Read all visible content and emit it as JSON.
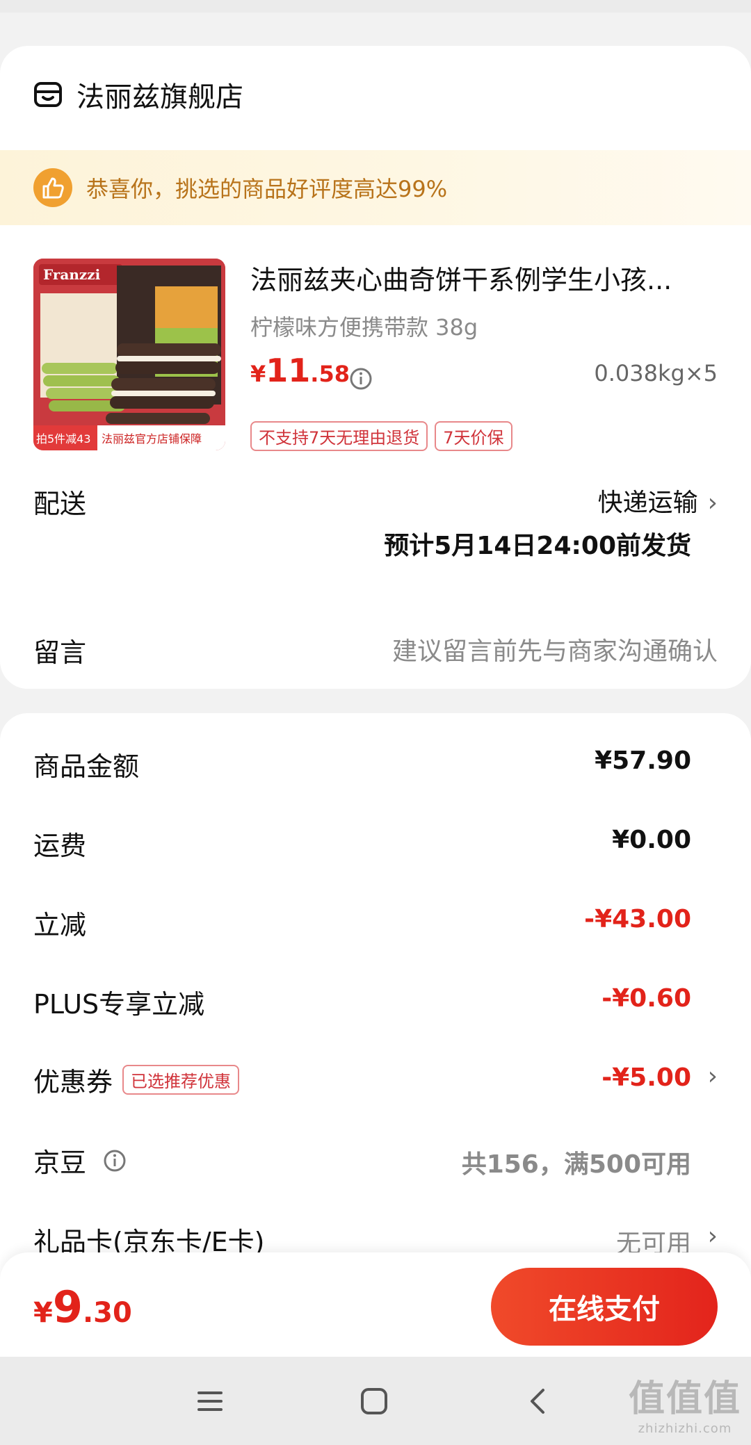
{
  "store": {
    "name": "法丽兹旗舰店",
    "icon": "store-icon"
  },
  "banner": {
    "text": "恭喜你，挑选的商品好评度高达99%",
    "icon": "thumbs-up-icon"
  },
  "product": {
    "title": "法丽兹夹心曲奇饼干系例学生小孩...",
    "spec": "柠檬味方便携带款 38g",
    "price_symbol": "¥",
    "price_int": "11",
    "price_dec": ".58",
    "qty": "0.038kg×5",
    "tags": [
      "不支持7天无理由退货",
      "7天价保"
    ],
    "image": {
      "brand": "Franzzi",
      "promo": "拍5件减43",
      "guarantee": "法丽兹官方店铺保障"
    }
  },
  "delivery": {
    "label": "配送",
    "method": "快递运输",
    "eta": "预计5月14日24:00前发货"
  },
  "message": {
    "label": "留言",
    "placeholder": "建议留言前先与商家沟通确认"
  },
  "fees": [
    {
      "label": "商品金额",
      "value": "¥57.90"
    },
    {
      "label": "运费",
      "value": "¥0.00"
    },
    {
      "label": "立减",
      "value": "-¥43.00"
    },
    {
      "label": "PLUS专享立减",
      "value": "-¥0.60"
    },
    {
      "label": "优惠券",
      "tag": "已选推荐优惠",
      "value": "-¥5.00"
    },
    {
      "label": "京豆",
      "value": "共156，满500可用"
    },
    {
      "label": "礼品卡(京东卡/E卡)",
      "value": "无可用"
    }
  ],
  "pay": {
    "symbol": "¥",
    "int": "9",
    "dec": ".30",
    "button": "在线支付"
  },
  "watermark": {
    "main": "值值值",
    "sub": "zhizhizhi.com"
  },
  "colors": {
    "accent_red": "#e2231a",
    "banner_text": "#b8731a",
    "banner_icon": "#f0a030"
  }
}
